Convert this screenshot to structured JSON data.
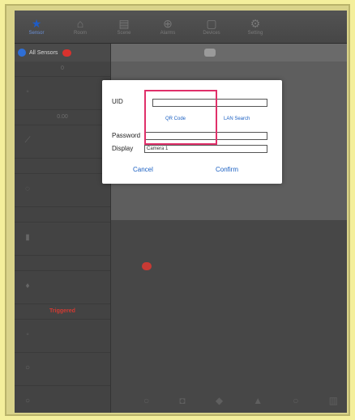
{
  "tabbar": {
    "tabs": [
      {
        "label": "Sensor",
        "icon": "star-icon",
        "glyph": "★",
        "active": true
      },
      {
        "label": "Room",
        "icon": "home-icon",
        "glyph": "⌂",
        "active": false
      },
      {
        "label": "Scene",
        "icon": "scene-icon",
        "glyph": "▤",
        "active": false
      },
      {
        "label": "Alarms",
        "icon": "alarm-icon",
        "glyph": "⊕",
        "active": false
      },
      {
        "label": "Devices",
        "icon": "devices-icon",
        "glyph": "▢",
        "active": false
      },
      {
        "label": "Setting",
        "icon": "settings-icon",
        "glyph": "⚙",
        "active": false
      }
    ]
  },
  "sidebar": {
    "header_label": "All Sensors",
    "header_badge": "",
    "values": {
      "v1": "0",
      "v2": "0.00",
      "v3": "Triggered"
    }
  },
  "dialog": {
    "uid_label": "UID",
    "uid_value": "",
    "qr_link": "QR Code",
    "lan_link": "LAN Search",
    "password_label": "Password",
    "password_value": "",
    "display_label": "Display",
    "display_value": "Camera 1",
    "cancel_label": "Cancel",
    "confirm_label": "Confirm"
  },
  "colors": {
    "accent": "#1e5cc7",
    "alert": "#d33a32",
    "highlight": "#e0306a",
    "border_bg": "#f4ef9c"
  }
}
